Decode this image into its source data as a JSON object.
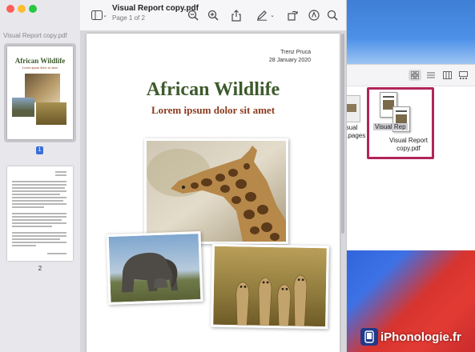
{
  "window": {
    "title": "Visual Report copy.pdf",
    "subtitle": "Page 1 of 2"
  },
  "sidebar": {
    "heading": "Visual Report copy.pdf",
    "thumbnails": [
      {
        "page_number": "1",
        "title": "African Wildlife",
        "subtitle": "Lorem ipsum dolor sit amet",
        "selected": true
      },
      {
        "page_number": "2",
        "selected": false
      }
    ]
  },
  "toolbar": {
    "icons": [
      "sidebar-toggle-icon",
      "chevron-down-icon",
      "zoom-out-icon",
      "zoom-in-icon",
      "share-icon",
      "markup-pen-icon",
      "chevron-down-icon",
      "rotate-icon",
      "annotate-icon",
      "search-icon"
    ]
  },
  "document": {
    "author": "Trenz Pruca",
    "date": "28 January 2020",
    "title": "African Wildlife",
    "subtitle": "Lorem ipsum dolor sit amet"
  },
  "finder": {
    "files": [
      {
        "label": "Visual Report.pages"
      },
      {
        "label": "Visual Report copy.pdf",
        "selected": true
      }
    ],
    "selected_label_line1": "Visual Report",
    "selected_label_line2": "copy.pdf",
    "drag_label": "Visual Rep",
    "partial_label_line1": "isual",
    "partial_label_line2": "t.pages"
  },
  "watermark": {
    "text": "iPhonologie.fr"
  },
  "colors": {
    "title_green": "#3d5a2c",
    "subtitle_brown": "#8a3b1e",
    "selection_box": "#b2245a",
    "selected_thumb_border": "#9a9a9e"
  }
}
